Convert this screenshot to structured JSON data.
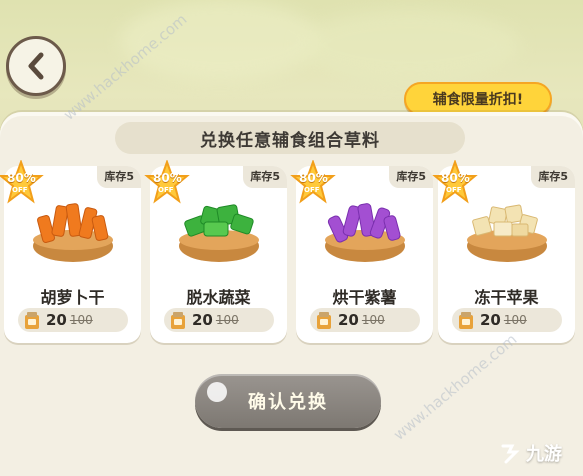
{
  "header": {
    "title": "兑换任意辅食组合草料"
  },
  "promo": {
    "label": "辅食限量折扣!"
  },
  "items": [
    {
      "name": "胡萝卜干",
      "stock": "库存5",
      "discount": "80%",
      "off": "OFF",
      "price": "20",
      "old_price": "100",
      "food_color": "#f07a1e"
    },
    {
      "name": "脱水蔬菜",
      "stock": "库存5",
      "discount": "80%",
      "off": "OFF",
      "price": "20",
      "old_price": "100",
      "food_color": "#3db23e"
    },
    {
      "name": "烘干紫薯",
      "stock": "库存5",
      "discount": "80%",
      "off": "OFF",
      "price": "20",
      "old_price": "100",
      "food_color": "#a34fd2"
    },
    {
      "name": "冻干苹果",
      "stock": "库存5",
      "discount": "80%",
      "off": "OFF",
      "price": "20",
      "old_price": "100",
      "food_color": "#f3e3b3"
    }
  ],
  "confirm": {
    "label": "确认兑换"
  },
  "watermark": {
    "text": "www.hackhome.com"
  },
  "logo": {
    "text": "九游"
  }
}
